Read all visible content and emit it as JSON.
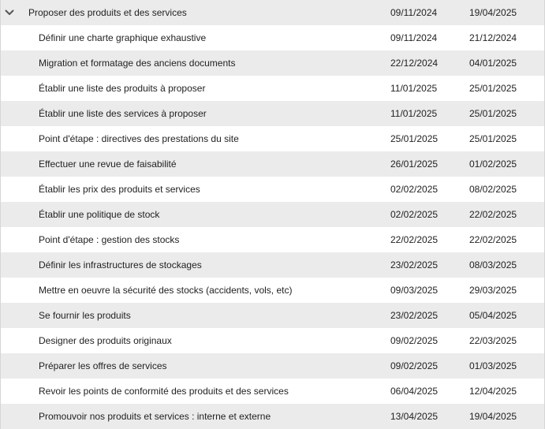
{
  "group": {
    "name": "Proposer des produits et des services",
    "start": "09/11/2024",
    "end": "19/04/2025",
    "expander_icon": "chevron-down-icon"
  },
  "tasks": [
    {
      "name": "Définir une charte graphique exhaustive",
      "start": "09/11/2024",
      "end": "21/12/2024"
    },
    {
      "name": "Migration et formatage des anciens documents",
      "start": "22/12/2024",
      "end": "04/01/2025"
    },
    {
      "name": "Établir une liste des produits à proposer",
      "start": "11/01/2025",
      "end": "25/01/2025"
    },
    {
      "name": "Établir une liste des services à proposer",
      "start": "11/01/2025",
      "end": "25/01/2025"
    },
    {
      "name": "Point d'étape : directives des prestations du site",
      "start": "25/01/2025",
      "end": "25/01/2025"
    },
    {
      "name": "Effectuer une revue de faisabilité",
      "start": "26/01/2025",
      "end": "01/02/2025"
    },
    {
      "name": "Établir les prix des produits et services",
      "start": "02/02/2025",
      "end": "08/02/2025"
    },
    {
      "name": "Établir une politique de stock",
      "start": "02/02/2025",
      "end": "22/02/2025"
    },
    {
      "name": "Point d'étape : gestion des stocks",
      "start": "22/02/2025",
      "end": "22/02/2025"
    },
    {
      "name": "Définir les infrastructures de stockages",
      "start": "23/02/2025",
      "end": "08/03/2025"
    },
    {
      "name": "Mettre en oeuvre la sécurité des stocks (accidents, vols, etc)",
      "start": "09/03/2025",
      "end": "29/03/2025"
    },
    {
      "name": "Se fournir les produits",
      "start": "23/02/2025",
      "end": "05/04/2025"
    },
    {
      "name": "Designer des produits originaux",
      "start": "09/02/2025",
      "end": "22/03/2025"
    },
    {
      "name": "Préparer les offres de services",
      "start": "09/02/2025",
      "end": "01/03/2025"
    },
    {
      "name": "Revoir les points de conformité des produits et des services",
      "start": "06/04/2025",
      "end": "12/04/2025"
    },
    {
      "name": "Promouvoir nos produits et services : interne et externe",
      "start": "13/04/2025",
      "end": "19/04/2025"
    }
  ],
  "colors": {
    "row_alt": "#ebebeb",
    "row_base": "#ffffff",
    "text": "#222222"
  }
}
